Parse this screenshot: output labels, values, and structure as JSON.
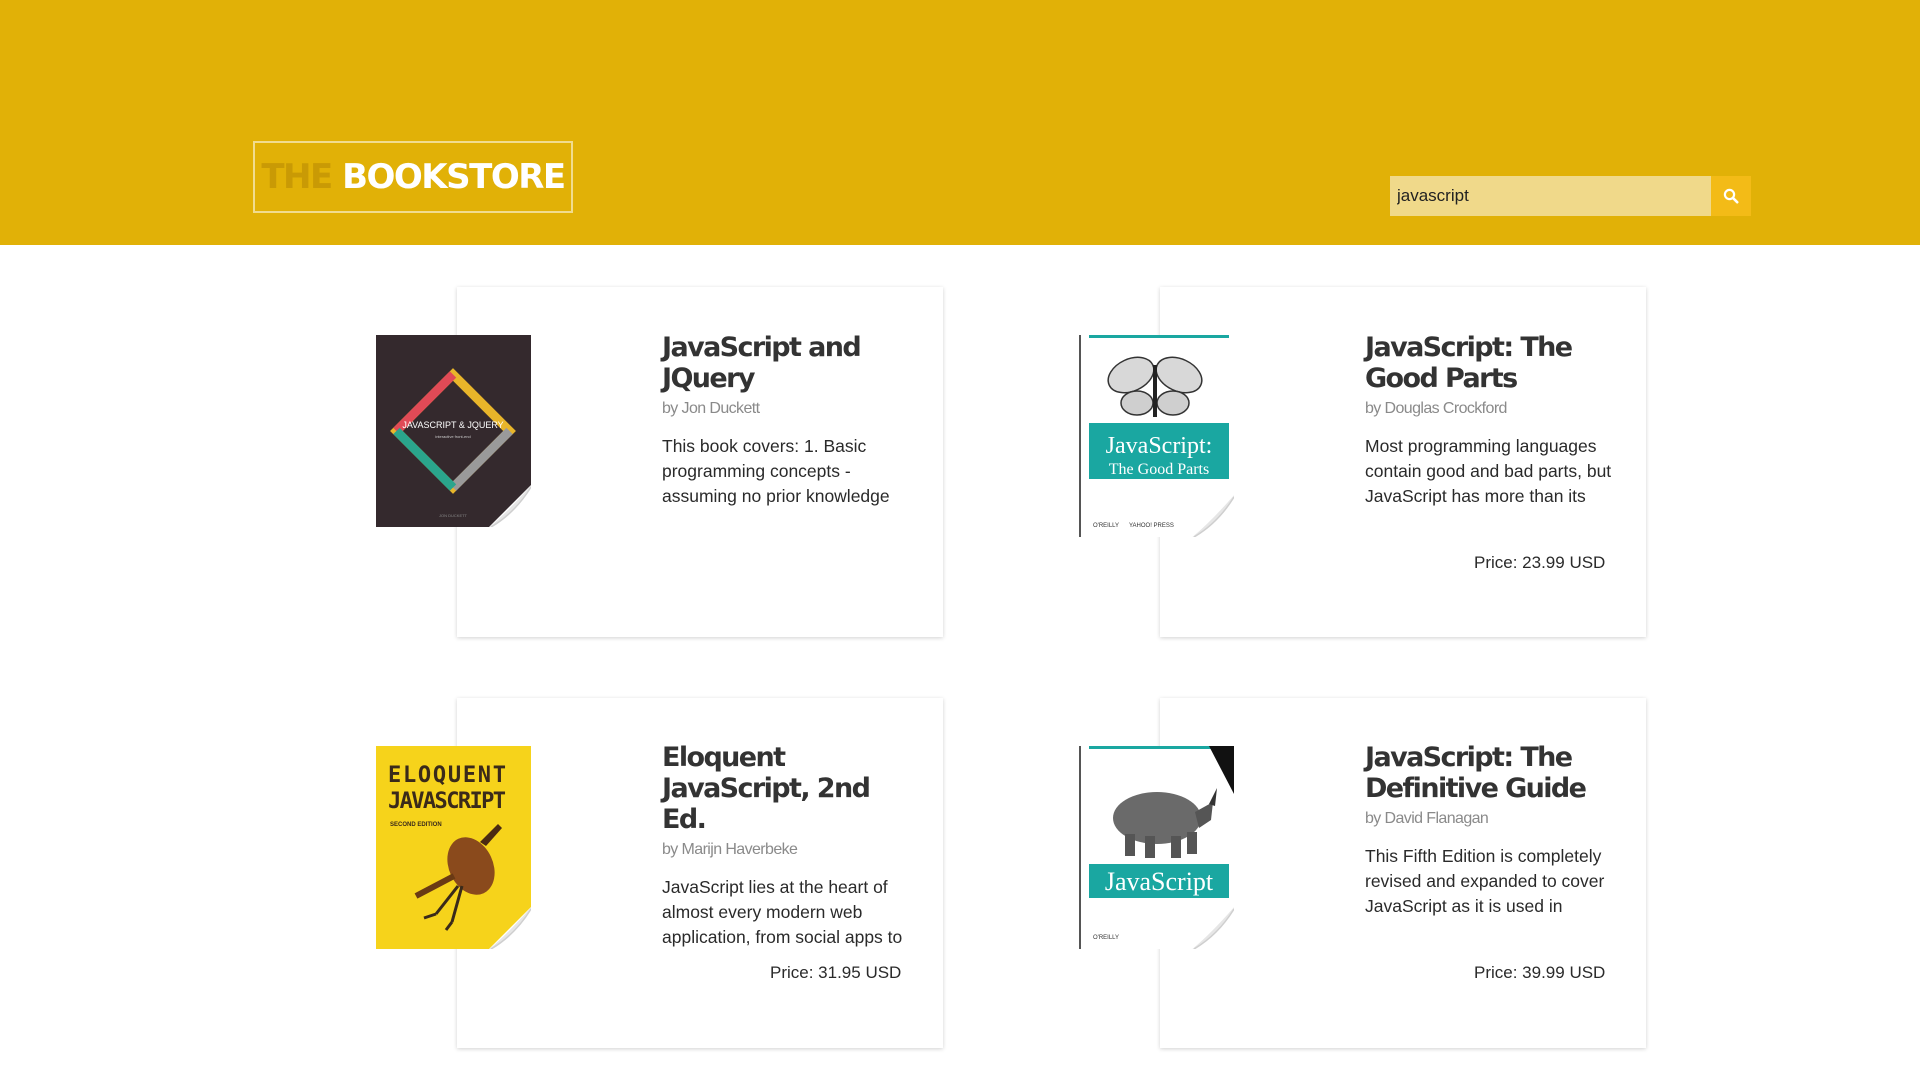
{
  "header": {
    "logo_the": "THE",
    "logo_bookstore": "BOOKSTORE",
    "background_color": "#e1b107"
  },
  "search": {
    "value": "javascript",
    "icon": "search-icon"
  },
  "books": [
    {
      "title": "JavaScript and JQuery",
      "author": "by Jon Duckett",
      "description": "This book covers: 1. Basic programming concepts - assuming no prior knowledge",
      "price": "",
      "cover_text": "JAVASCRIPT & JQUERY"
    },
    {
      "title": "JavaScript: The Good Parts",
      "author": "by Douglas Crockford",
      "description": "Most programming languages contain good and bad parts, but JavaScript has more than its",
      "price": "Price: 23.99 USD",
      "cover_text": "JavaScript: The Good Parts"
    },
    {
      "title": "Eloquent JavaScript, 2nd Ed.",
      "author": "by Marijn Haverbeke",
      "description": "JavaScript lies at the heart of almost every modern web application, from social apps to",
      "price": "Price: 31.95 USD",
      "cover_text": "ELOQUENT JAVASCRIPT"
    },
    {
      "title": "JavaScript: The Definitive Guide",
      "author": "by David Flanagan",
      "description": "This Fifth Edition is completely revised and expanded to cover JavaScript as it is used in",
      "price": "Price: 39.99 USD",
      "cover_text": "JavaScript"
    }
  ]
}
